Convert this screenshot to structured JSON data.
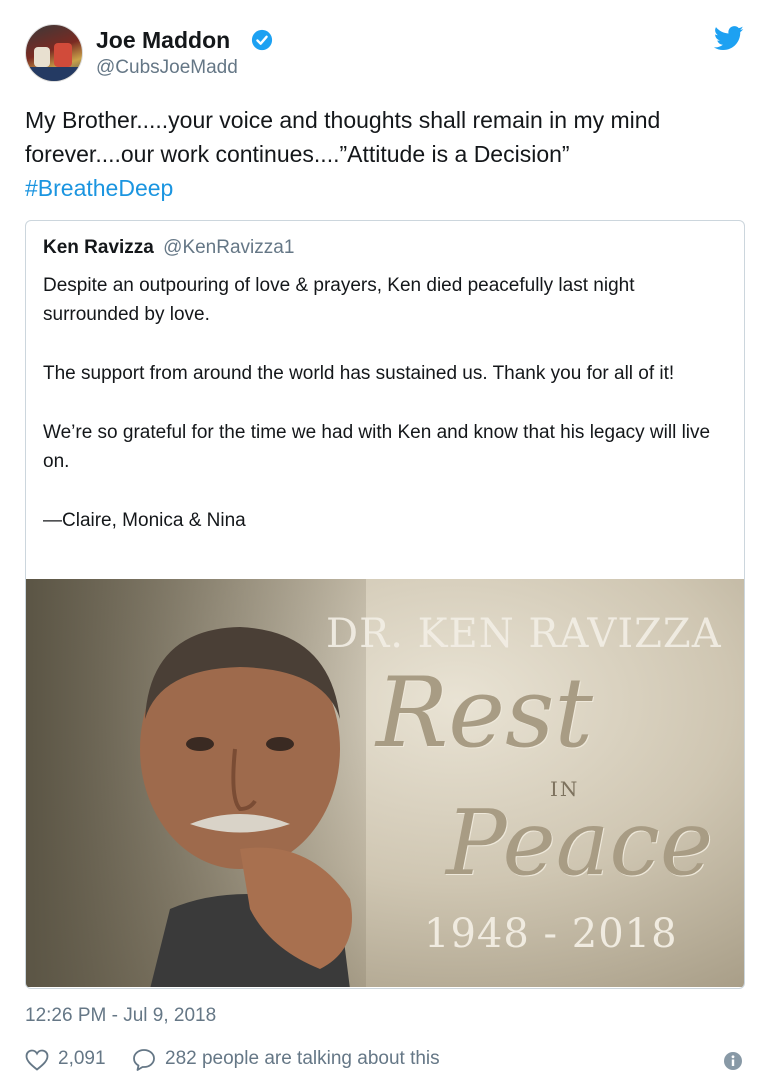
{
  "tweet": {
    "author_name": "Joe Maddon",
    "author_handle": "@CubsJoeMadd",
    "text_line1": "My Brother.....your voice and thoughts shall remain in my mind",
    "text_line2": "forever....our work continues....”Attitude is a Decision”",
    "hashtag": "#BreatheDeep",
    "timestamp": "12:26 PM - Jul 9, 2018",
    "like_count": "2,091",
    "talking": "282 people are talking about this"
  },
  "quoted": {
    "author_name": "Ken Ravizza",
    "author_handle": "@KenRavizza1",
    "paragraphs": [
      "Despite an outpouring of love & prayers, Ken died peacefully last night surrounded by love.",
      "The support from around the world has sustained us. Thank you for all of it!",
      "We’re so grateful for the time we had with Ken and know that his legacy will live on.",
      "—Claire, Monica & Nina"
    ],
    "image": {
      "title": "DR. KEN RAVIZZA",
      "rest": "Rest",
      "in": "IN",
      "peace": "Peace",
      "years": "1948 - 2018"
    }
  },
  "icons": {
    "verified": "verified-badge-icon",
    "bird": "twitter-bird-icon",
    "like": "heart-icon",
    "reply": "speech-bubble-icon",
    "info": "info-icon"
  },
  "colors": {
    "link": "#1b95e0",
    "secondary": "#657786",
    "verified": "#1da1f2",
    "border": "#ccd6dd"
  }
}
